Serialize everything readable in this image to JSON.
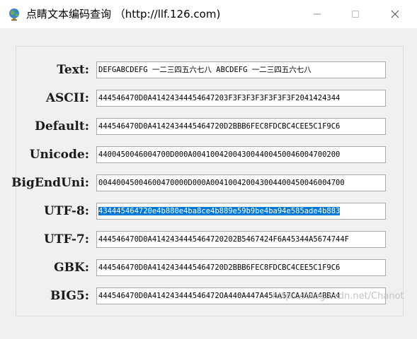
{
  "window": {
    "title": "点睛文本编码查询 （http://llf.126.com)",
    "icon": "globe-icon",
    "minimize_glyph": "─",
    "maximize_glyph": "☐",
    "close_glyph": "✕"
  },
  "rows": [
    {
      "label": "Text:",
      "value": "DEFGABCDEFG 一二三四五六七八 ABCDEFG 一二三四五六七八",
      "selected": false
    },
    {
      "label": "ASCII:",
      "value": "444546470D0A41424344454647203F3F3F3F3F3F3F3F2041424344",
      "selected": false
    },
    {
      "label": "Default:",
      "value": "444546470D0A4142434445464720D2BBB6FEC8FDCBC4CEE5C1F9C6",
      "selected": false
    },
    {
      "label": "Unicode:",
      "value": "4400450046004700D000A004100420043004400450046004700200",
      "selected": false
    },
    {
      "label": "BigEndUni:",
      "value": "00440045004600470000D000A004100420043004400450046004700",
      "selected": false
    },
    {
      "label": "UTF-8:",
      "value": "434445464720e4b880e4ba8ce4b889e59b9be4ba94e585ade4b883",
      "selected": true
    },
    {
      "label": "UTF-7:",
      "value": "444546470D0A4142434445464720202B5467424F6A45344A5674744F",
      "selected": false
    },
    {
      "label": "GBK:",
      "value": "444546470D0A4142434445464720D2BBB6FEC8FDCBC4CEE5C1F9C6",
      "selected": false
    },
    {
      "label": "BIG5:",
      "value": "444546470D0A414243444546472OA440A447A454A57CA4ADA4BBA4",
      "selected": false
    }
  ],
  "watermark": "https://blog.csdn.net/Chanot"
}
